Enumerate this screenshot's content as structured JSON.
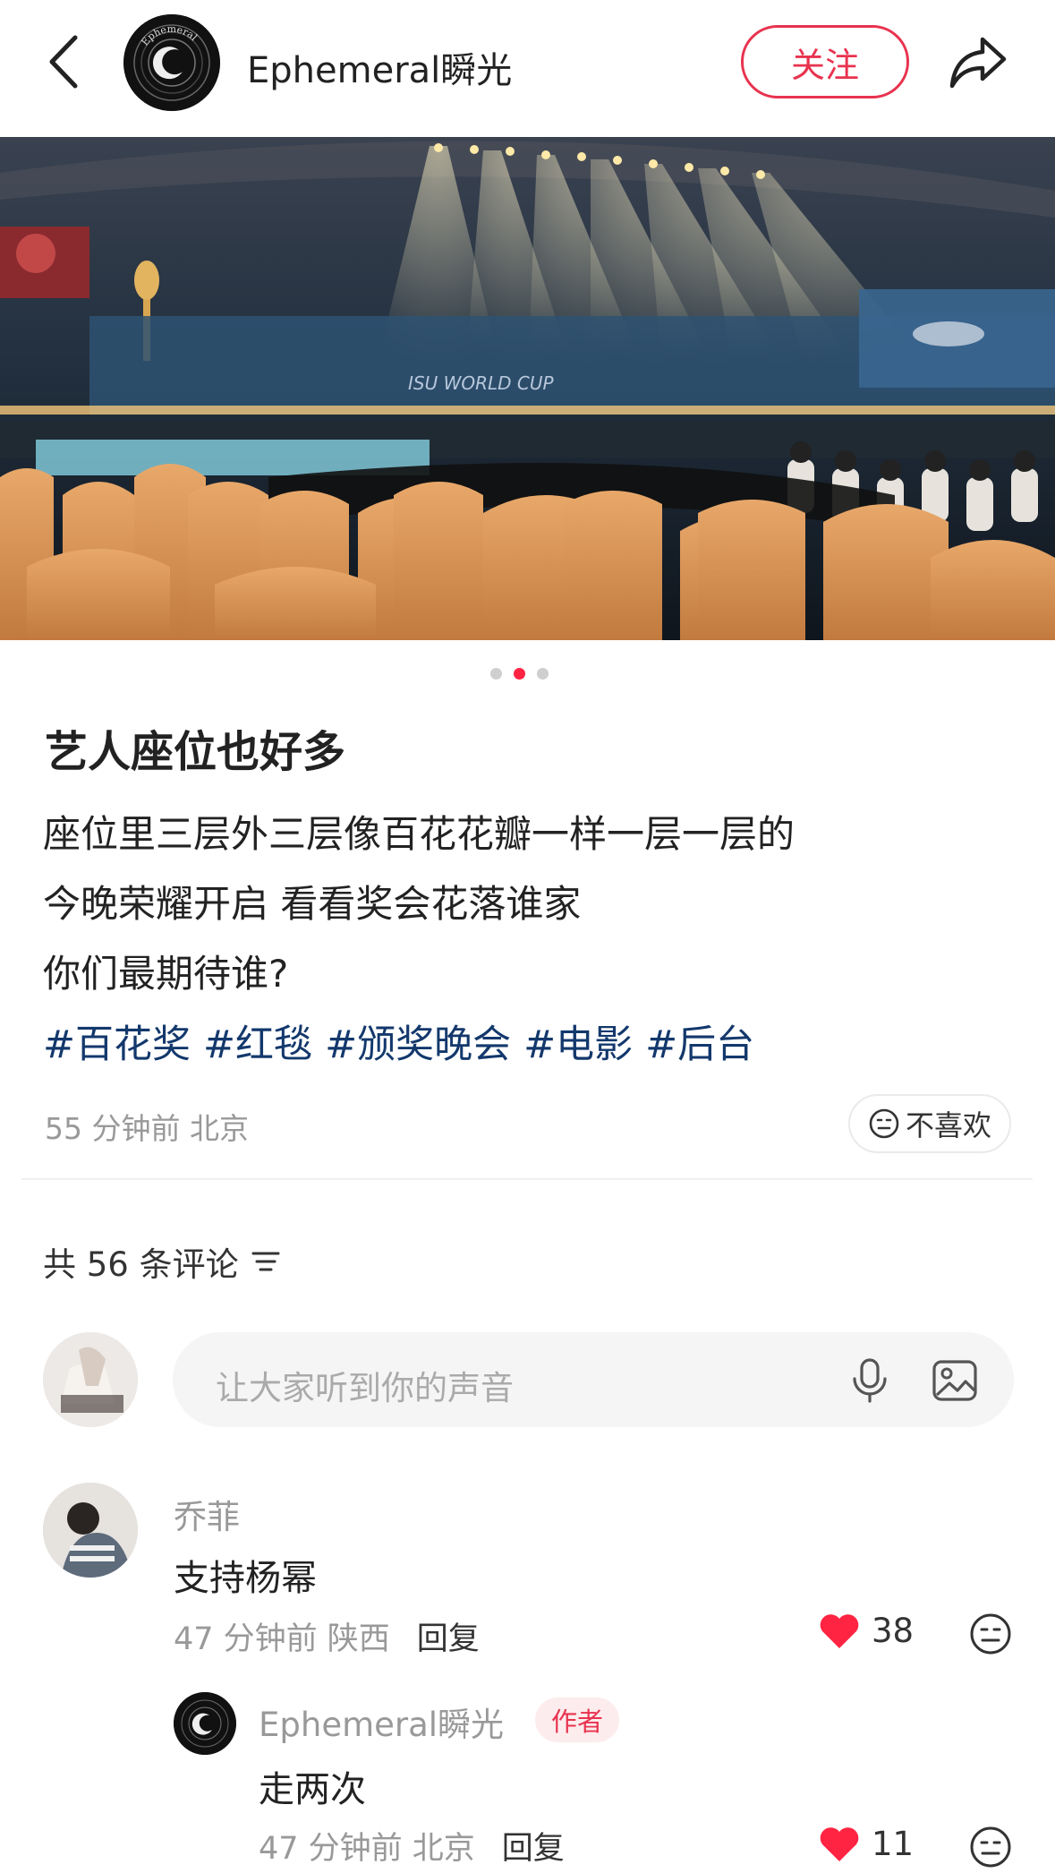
{
  "header": {
    "author_name": "Ephemeral瞬光",
    "follow_label": "关注",
    "author_avatar_text": "Ephemeral"
  },
  "photo": {
    "banner_text": "ISU WORLD CUP",
    "carousel_total": 3,
    "carousel_active": 2
  },
  "post": {
    "title": "艺人座位也好多",
    "lines": [
      "座位里三层外三层像百花花瓣一样一层一层的",
      "今晚荣耀开启 看看奖会花落谁家",
      "你们最期待谁?"
    ],
    "tags": [
      "#百花奖",
      "#红毯",
      "#颁奖晚会",
      "#电影",
      "#后台"
    ],
    "meta": "55 分钟前 北京",
    "dislike_label": "不喜欢"
  },
  "comments_header": {
    "count_label": "共 56 条评论"
  },
  "comment_input": {
    "placeholder": "让大家听到你的声音"
  },
  "comments": [
    {
      "name": "乔菲",
      "text": "支持杨幂",
      "meta": "47 分钟前 陕西",
      "reply_label": "回复",
      "likes": "38"
    }
  ],
  "replies": [
    {
      "name": "Ephemeral瞬光",
      "badge": "作者",
      "text": "走两次",
      "meta": "47 分钟前 北京",
      "reply_label": "回复",
      "likes": "11"
    }
  ],
  "colors": {
    "accent": "#ff2442",
    "tag": "#13386c",
    "muted": "#999999"
  }
}
